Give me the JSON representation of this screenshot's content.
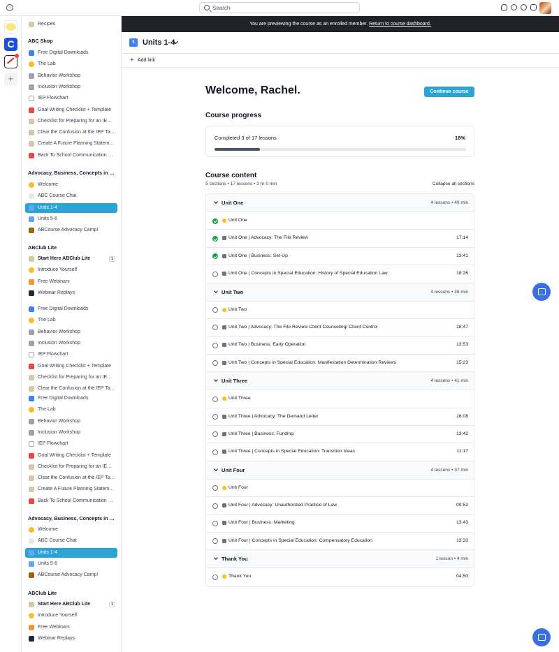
{
  "search": {
    "placeholder": "Search"
  },
  "colors": {
    "accent": "#2aa3d6",
    "banner_bg": "#1f2328",
    "complete": "#16a34a",
    "fab": "#3b6fe0"
  },
  "rail": {
    "apps": [
      "app-1",
      "C",
      "app-3"
    ],
    "add": "+"
  },
  "sidebar": {
    "recipes": {
      "label": "Recipes",
      "icon": "chef-hat-icon"
    },
    "sections": [
      {
        "title": "ABC Shop",
        "items": [
          {
            "label": "Free Digital Downloads",
            "icon": "new-badge-icon"
          },
          {
            "label": "The Lab",
            "icon": "lemon-icon"
          },
          {
            "label": "Behavior Workshop",
            "icon": "camera-icon"
          },
          {
            "label": "Inclusion Workshop",
            "icon": "camera-icon"
          },
          {
            "label": "IEP Flowchart",
            "icon": "chart-icon"
          },
          {
            "label": "Goal Writing Checklist + Template",
            "icon": "abacus-icon"
          },
          {
            "label": "Checklist for Preparing for an IEP ...",
            "icon": "notepad-icon"
          },
          {
            "label": "Clear the Confusion at the IEP Ta...",
            "icon": "notepad-icon"
          },
          {
            "label": "Create A Future Planning Statem...",
            "icon": "notepad-icon"
          },
          {
            "label": "Back To School Communication B...",
            "icon": "backpack-icon"
          }
        ]
      },
      {
        "title": "Advocacy, Business, Concepts in Sp...",
        "items": [
          {
            "label": "Welcome",
            "icon": "wave-icon"
          },
          {
            "label": "ABC Course Chat",
            "icon": "speech-bubble-icon"
          },
          {
            "label": "Units 1-4",
            "icon": "one-keycap-icon"
          },
          {
            "label": "Units 5-6",
            "icon": "two-keycap-icon"
          },
          {
            "label": "ABCourse Advocacy Camp!",
            "icon": "tent-icon"
          }
        ]
      },
      {
        "title": "ABClub Lite",
        "items": [
          {
            "label": "Start Here ABClub Lite",
            "icon": "chef-hat-icon",
            "badge": "1"
          },
          {
            "label": "Introduce Yourself",
            "icon": "wave-icon"
          },
          {
            "label": "Free Webinars",
            "icon": "calendar-icon"
          },
          {
            "label": "Webinar Replays",
            "icon": "video-icon"
          }
        ]
      },
      {
        "title": "",
        "items": [
          {
            "label": "Free Digital Downloads",
            "icon": "new-badge-icon"
          },
          {
            "label": "The Lab",
            "icon": "lemon-icon"
          },
          {
            "label": "Behavior Workshop",
            "icon": "camera-icon"
          },
          {
            "label": "Inclusion Workshop",
            "icon": "camera-icon"
          },
          {
            "label": "IEP Flowchart",
            "icon": "chart-icon"
          },
          {
            "label": "Goal Writing Checklist + Template",
            "icon": "abacus-icon"
          },
          {
            "label": "Checklist for Preparing for an IEP ...",
            "icon": "notepad-icon"
          },
          {
            "label": "Clear the Confusion at the IEP Ta...",
            "icon": "notepad-icon"
          },
          {
            "label": "Free Digital Downloads",
            "icon": "new-badge-icon"
          },
          {
            "label": "The Lab",
            "icon": "lemon-icon"
          },
          {
            "label": "Behavior Workshop",
            "icon": "camera-icon"
          },
          {
            "label": "Inclusion Workshop",
            "icon": "camera-icon"
          },
          {
            "label": "IEP Flowchart",
            "icon": "chart-icon"
          },
          {
            "label": "Goal Writing Checklist + Template",
            "icon": "abacus-icon"
          },
          {
            "label": "Checklist for Preparing for an IEP ...",
            "icon": "notepad-icon"
          },
          {
            "label": "Clear the Confusion at the IEP Ta...",
            "icon": "notepad-icon"
          },
          {
            "label": "Create A Future Planning Statem...",
            "icon": "notepad-icon"
          },
          {
            "label": "Back To School Communication B...",
            "icon": "backpack-icon"
          }
        ]
      },
      {
        "title": "Advocacy, Business, Concepts in Sp...",
        "items": [
          {
            "label": "Welcome",
            "icon": "wave-icon"
          },
          {
            "label": "ABC Course Chat",
            "icon": "speech-bubble-icon"
          },
          {
            "label": "Units 1-4",
            "icon": "one-keycap-icon"
          },
          {
            "label": "Units 5-6",
            "icon": "two-keycap-icon"
          },
          {
            "label": "ABCourse Advocacy Camp!",
            "icon": "tent-icon"
          }
        ]
      },
      {
        "title": "ABClub Lite",
        "items": [
          {
            "label": "Start Here ABClub Lite",
            "icon": "chef-hat-icon",
            "badge": "1"
          },
          {
            "label": "Introduce Yourself",
            "icon": "wave-icon"
          },
          {
            "label": "Free Webinars",
            "icon": "calendar-icon"
          },
          {
            "label": "Webinar Replays",
            "icon": "video-icon"
          }
        ]
      }
    ]
  },
  "banner": {
    "text": "You are previewing the course as an enrolled member.",
    "link": "Return to course dashboard."
  },
  "header": {
    "title": "Units 1-4",
    "add_link": "Add link",
    "icon_text": "1"
  },
  "main": {
    "welcome": "Welcome, Rachel.",
    "continue_label": "Continue course",
    "progress_title": "Course progress",
    "progress_text": "Completed 3 of 17 lessons",
    "progress_percent_label": "18%",
    "progress_fraction": 0.18,
    "content_title": "Course content",
    "content_meta": "5 sections • 17 lessons • 3 hr 0 min",
    "collapse_all": "Collapse all sections"
  },
  "sections": [
    {
      "title": "Unit One",
      "meta": "4 lessons • 49 min",
      "lessons": [
        {
          "title": "Unit One",
          "duration": "",
          "done": true,
          "icon": "wave-icon"
        },
        {
          "title": "Unit One | Advocacy: The File Review",
          "duration": "17:14",
          "done": true,
          "icon": "camera-icon"
        },
        {
          "title": "Unit One | Business: Set-Up",
          "duration": "13:41",
          "done": true,
          "icon": "camera-icon"
        },
        {
          "title": "Unit One | Concepts in Special Education: History of Special Education Law",
          "duration": "18:26",
          "done": false,
          "icon": "camera-icon"
        }
      ]
    },
    {
      "title": "Unit Two",
      "meta": "4 lessons • 48 min",
      "lessons": [
        {
          "title": "Unit Two",
          "duration": "",
          "done": false,
          "icon": "wave-icon"
        },
        {
          "title": "Unit Two | Advocacy: The File Review Client Counseling/ Client Control",
          "duration": "18:47",
          "done": false,
          "icon": "camera-icon"
        },
        {
          "title": "Unit Two | Business: Early Operation",
          "duration": "13:53",
          "done": false,
          "icon": "camera-icon"
        },
        {
          "title": "Unit Two | Concepts in Special Education: Manifestation Determination Reviews",
          "duration": "15:23",
          "done": false,
          "icon": "camera-icon"
        }
      ]
    },
    {
      "title": "Unit Three",
      "meta": "4 lessons • 41 min",
      "lessons": [
        {
          "title": "Unit Three",
          "duration": "",
          "done": false,
          "icon": "wave-icon"
        },
        {
          "title": "Unit Three | Advocacy: The Demand Letter",
          "duration": "16:08",
          "done": false,
          "icon": "camera-icon"
        },
        {
          "title": "Unit Three | Business: Funding",
          "duration": "13:42",
          "done": false,
          "icon": "camera-icon"
        },
        {
          "title": "Unit Three | Concepts in Special Education: Transition Ideas",
          "duration": "11:17",
          "done": false,
          "icon": "camera-icon"
        }
      ]
    },
    {
      "title": "Unit Four",
      "meta": "4 lessons • 37 min",
      "lessons": [
        {
          "title": "Unit Four",
          "duration": "",
          "done": false,
          "icon": "wave-icon"
        },
        {
          "title": "Unit Four | Advocacy: Unauthorized Practice of Law",
          "duration": "09:52",
          "done": false,
          "icon": "camera-icon"
        },
        {
          "title": "Unit Four | Business: Marketing",
          "duration": "13:43",
          "done": false,
          "icon": "camera-icon"
        },
        {
          "title": "Unit Four | Concepts in Special Education: Compensatory Education",
          "duration": "13:33",
          "done": false,
          "icon": "camera-icon"
        }
      ]
    },
    {
      "title": "Thank You",
      "meta": "1 lesson • 4 min",
      "lessons": [
        {
          "title": "Thank You",
          "duration": "04:50",
          "done": false,
          "icon": "wave-icon"
        }
      ]
    }
  ]
}
